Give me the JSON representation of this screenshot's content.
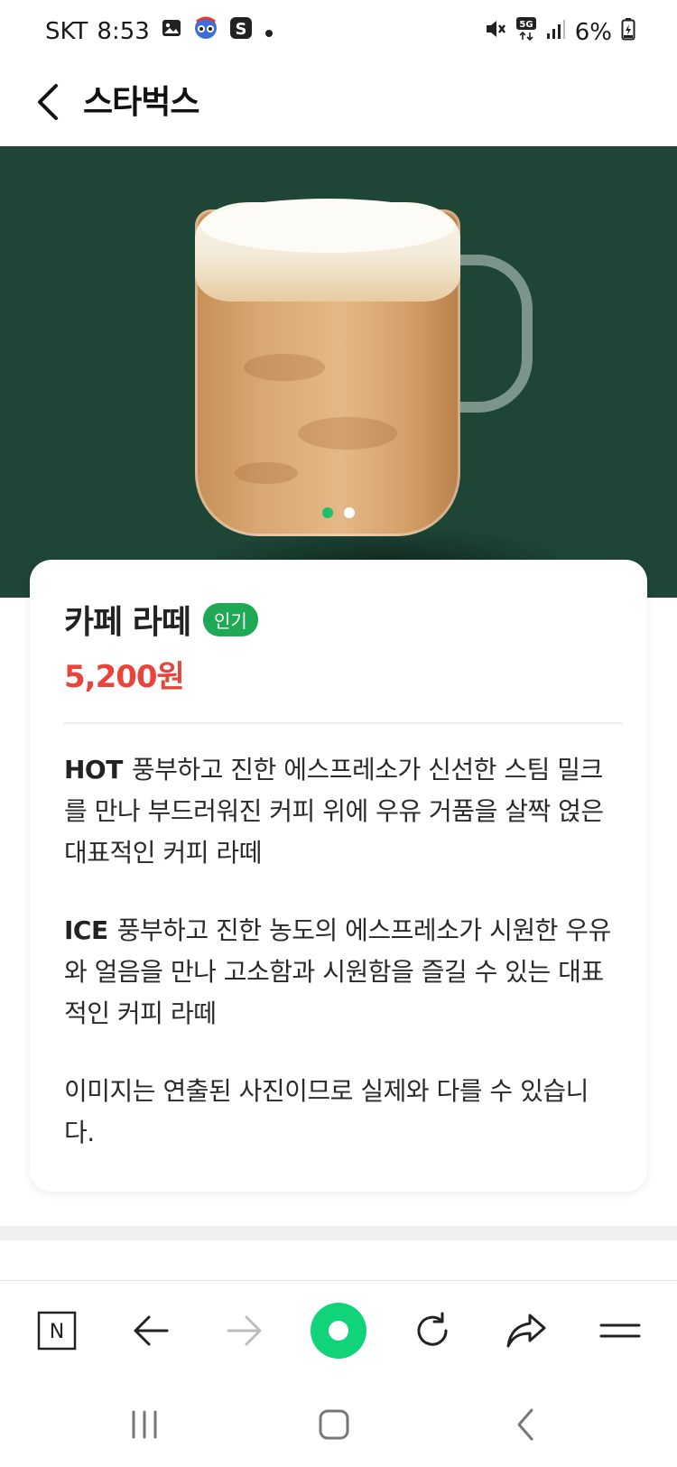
{
  "status_bar": {
    "carrier": "SKT",
    "time": "8:53",
    "battery": "6%",
    "icons": [
      "gallery-icon",
      "app-icon",
      "s-app-icon",
      "dot-icon",
      "mute-icon",
      "5g-icon",
      "signal-icon",
      "battery-icon"
    ]
  },
  "header": {
    "title": "스타벅스"
  },
  "carousel": {
    "slide_count": 2,
    "active_index": 0
  },
  "product": {
    "name": "카페 라떼",
    "badge": "인기",
    "price": "5,200원",
    "hot_label": "HOT",
    "hot_desc": "풍부하고 진한 에스프레소가 신선한 스팀 밀크를 만나 부드러워진 커피 위에 우유 거품을 살짝 얹은 대표적인 커피 라떼",
    "ice_label": "ICE",
    "ice_desc": "풍부하고 진한 농도의 에스프레소가 시원한 우유와 얼음을 만나 고소함과 시원함을 즐길 수 있는 대표적인 커피 라떼",
    "note": "이미지는 연출된 사진이므로 실제와 다를 수 있습니다."
  },
  "browser_toolbar": {
    "items": [
      "naver-icon",
      "back-arrow-icon",
      "forward-arrow-icon",
      "home-icon",
      "refresh-icon",
      "share-icon",
      "menu-icon"
    ]
  },
  "colors": {
    "hero_bg": "#1e4536",
    "price": "#e8443a",
    "badge": "#1eaa55",
    "home_button": "#10d37a"
  }
}
